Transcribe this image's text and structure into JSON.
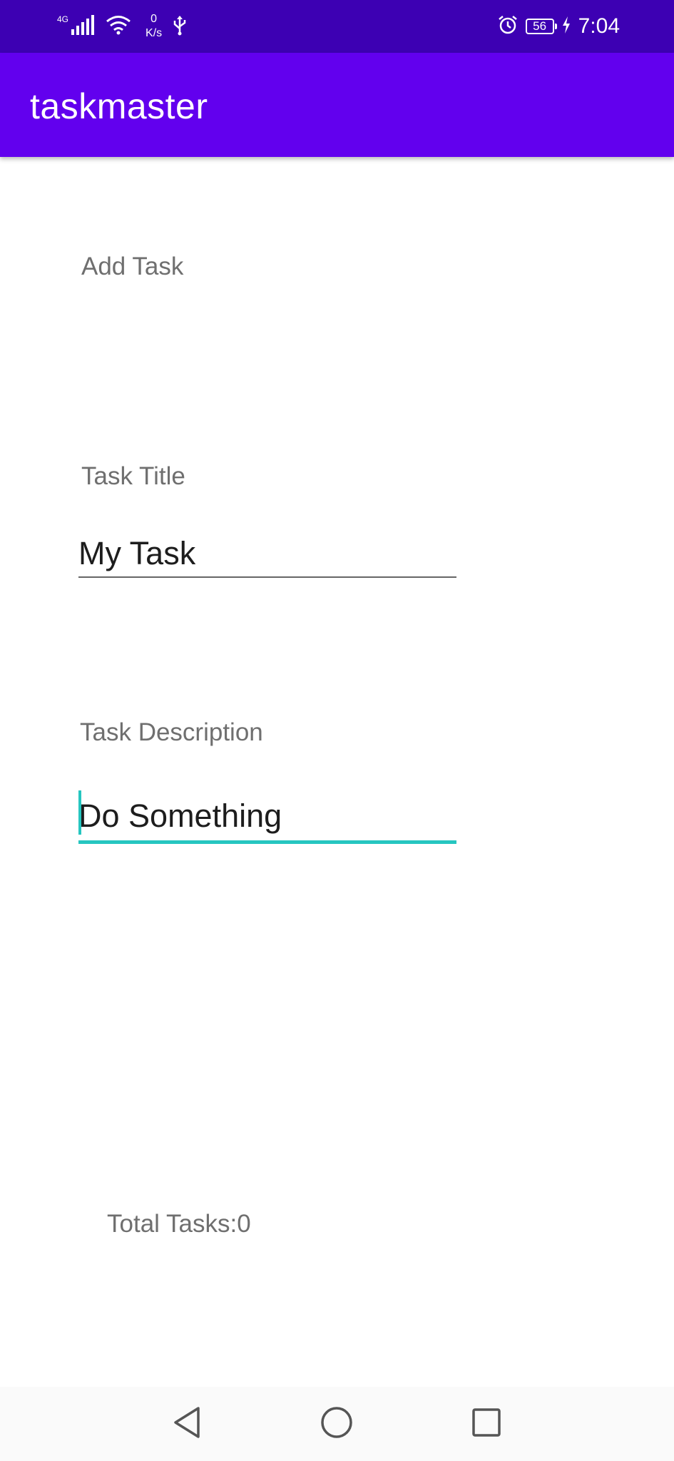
{
  "colors": {
    "status_bar": "#3d00b3",
    "app_bar": "#6200ee",
    "accent": "#26c6c0",
    "label_text": "#6f6f6f",
    "input_text": "#1d1d1d"
  },
  "status_bar": {
    "network_type": "4G",
    "net_speed_value": "0",
    "net_speed_unit": "K/s",
    "battery": "56",
    "time": "7:04",
    "icons": [
      "signal-icon",
      "wifi-icon",
      "usb-icon",
      "alarm-icon",
      "battery-icon",
      "charging-icon"
    ]
  },
  "app_bar": {
    "title": "taskmaster"
  },
  "form": {
    "heading": "Add Task",
    "title_label": "Task Title",
    "title_value": "My Task",
    "description_label": "Task Description",
    "description_value": "Do Something"
  },
  "footer": {
    "total_tasks": "Total Tasks:0"
  },
  "nav_bar": {
    "icons": [
      "back-icon",
      "home-icon",
      "recents-icon"
    ]
  }
}
